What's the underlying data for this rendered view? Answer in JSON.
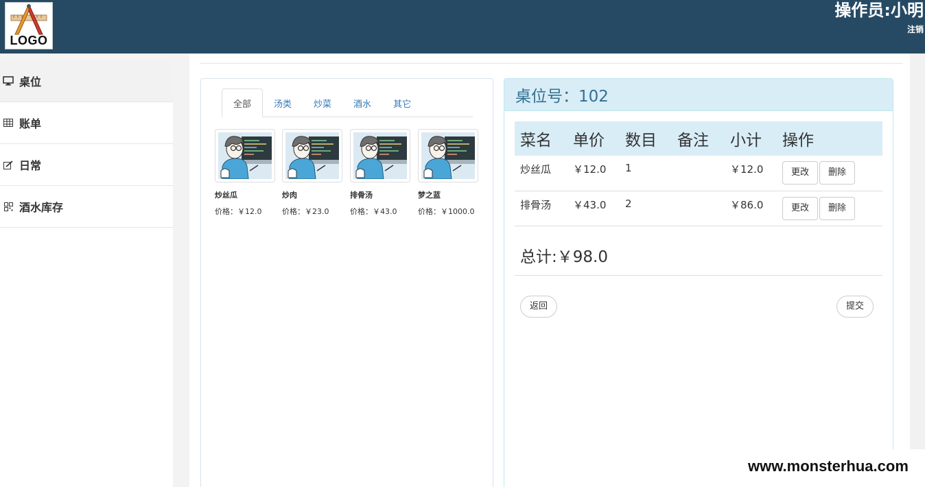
{
  "header": {
    "logo_text": "LOGO",
    "operator": "操作员:小明",
    "logout": "注销"
  },
  "sidebar": {
    "items": [
      {
        "label": "桌位",
        "icon": "monitor-icon"
      },
      {
        "label": "账单",
        "icon": "table-icon"
      },
      {
        "label": "日常",
        "icon": "edit-icon"
      },
      {
        "label": "酒水库存",
        "icon": "grid-icon"
      }
    ]
  },
  "menu": {
    "tabs": [
      "全部",
      "汤类",
      "炒菜",
      "酒水",
      "其它"
    ],
    "active_tab": "全部",
    "price_label": "价格：",
    "products": [
      {
        "name": "炒丝瓜",
        "price": "￥12.0"
      },
      {
        "name": "炒肉",
        "price": "￥23.0"
      },
      {
        "name": "排骨汤",
        "price": "￥43.0"
      },
      {
        "name": "梦之蓝",
        "price": "￥1000.0"
      }
    ]
  },
  "order": {
    "title": "桌位号：102",
    "headers": [
      "菜名",
      "单价",
      "数目",
      "备注",
      "小计",
      "操作"
    ],
    "rows": [
      {
        "name": "炒丝瓜",
        "price": "￥12.0",
        "qty": "1",
        "note": "",
        "subtotal": "￥12.0"
      },
      {
        "name": "排骨汤",
        "price": "￥43.0",
        "qty": "2",
        "note": "",
        "subtotal": "￥86.0"
      }
    ],
    "edit_label": "更改",
    "delete_label": "删除",
    "total": "总计:￥98.0",
    "back_label": "返回",
    "submit_label": "提交"
  },
  "watermark": "www.monsterhua.com",
  "colors": {
    "header_bg": "#264a63",
    "panel_heading_bg": "#d9edf7",
    "link": "#337ab7"
  }
}
